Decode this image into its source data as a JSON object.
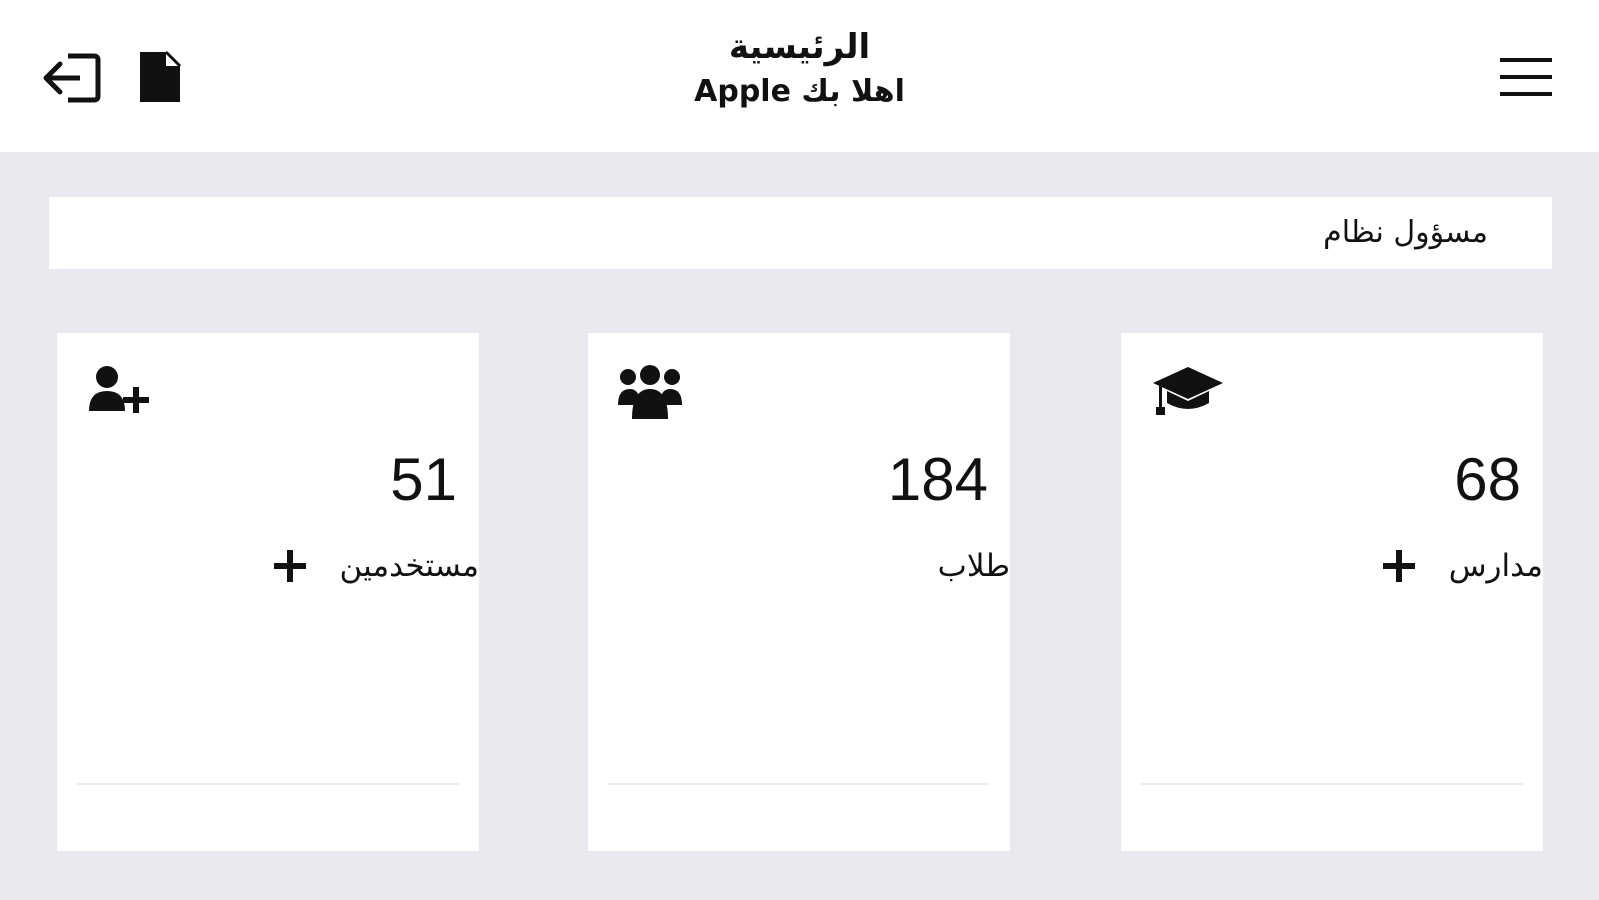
{
  "header": {
    "title": "الرئيسية",
    "welcome": "اهلا بك Apple",
    "menu_icon": "hamburger-menu-icon",
    "document_icon": "document-icon",
    "logout_icon": "sign-out-icon"
  },
  "role": {
    "label": "مسؤول نظام"
  },
  "cards": {
    "users": {
      "count": "51",
      "label": "مستخدمين",
      "icon": "user-plus-icon",
      "add_icon": "plus-icon"
    },
    "students": {
      "count": "184",
      "label": "طلاب",
      "icon": "users-group-icon"
    },
    "schools": {
      "count": "68",
      "label": "مدارس",
      "icon": "graduation-cap-icon",
      "add_icon": "plus-icon"
    }
  },
  "colors": {
    "page_background": "#e8e8ee",
    "card_background": "#ffffff",
    "text": "#111111"
  }
}
